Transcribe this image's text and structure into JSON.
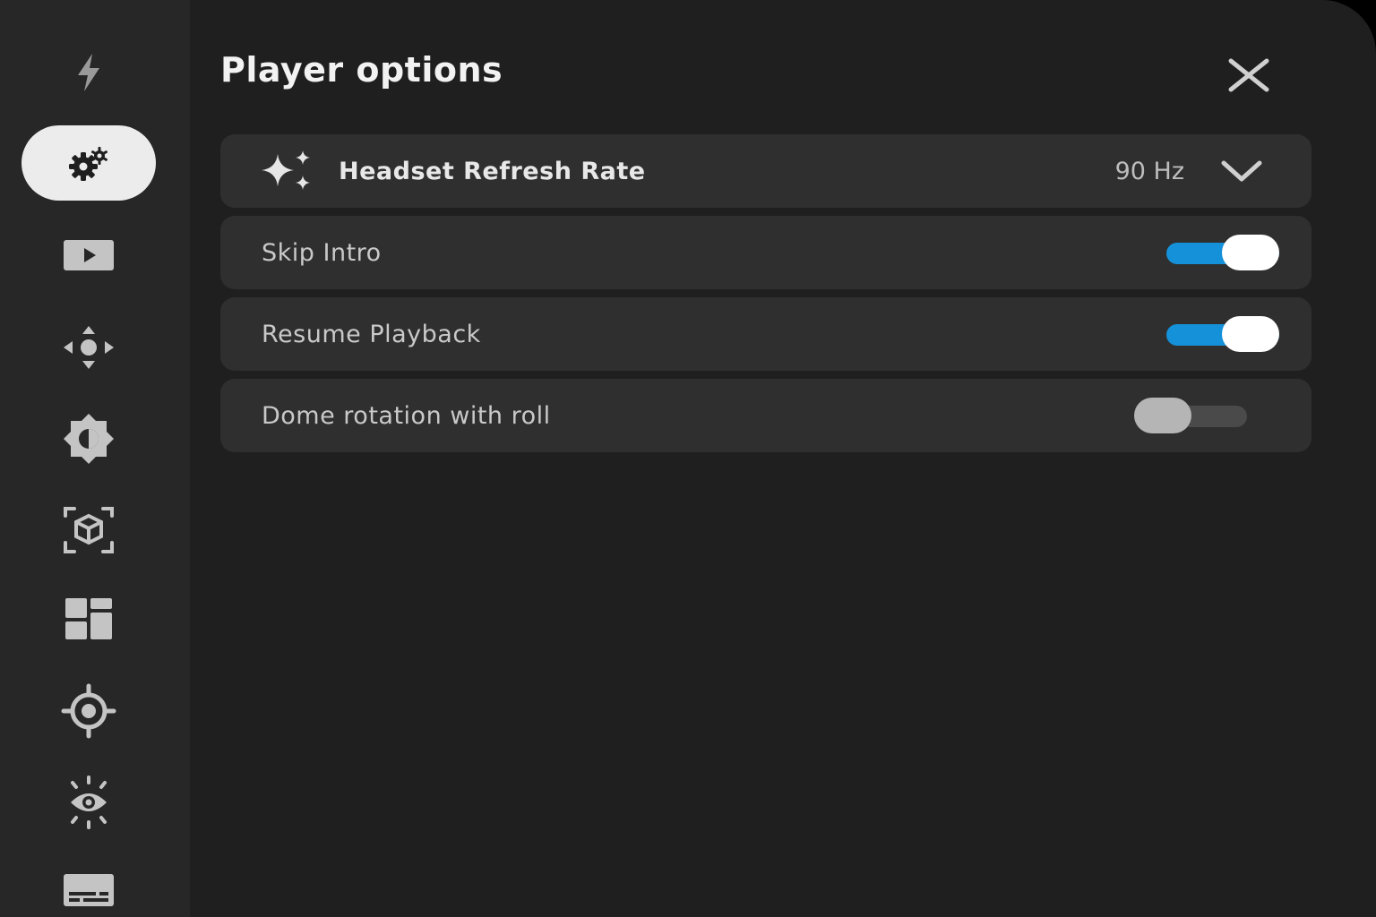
{
  "header": {
    "title": "Player options",
    "close_icon": "close-icon"
  },
  "sidebar": {
    "items": [
      {
        "icon": "lightning-icon",
        "active": false
      },
      {
        "icon": "gears-icon",
        "active": true
      },
      {
        "icon": "video-play-icon",
        "active": false
      },
      {
        "icon": "move-arrows-icon",
        "active": false
      },
      {
        "icon": "brightness-icon",
        "active": false
      },
      {
        "icon": "3d-cube-icon",
        "active": false
      },
      {
        "icon": "layout-grid-icon",
        "active": false
      },
      {
        "icon": "target-icon",
        "active": false
      },
      {
        "icon": "eye-sun-icon",
        "active": false
      },
      {
        "icon": "subtitles-icon",
        "active": false
      }
    ]
  },
  "settings": {
    "refresh_rate": {
      "label": "Headset Refresh Rate",
      "value": "90 Hz",
      "icon": "sparkle-icon"
    },
    "skip_intro": {
      "label": "Skip Intro",
      "enabled": true
    },
    "resume_playback": {
      "label": "Resume Playback",
      "enabled": true
    },
    "dome_rotation": {
      "label": "Dome rotation with roll",
      "enabled": false
    }
  },
  "colors": {
    "background": "#1f1f1f",
    "sidebar": "#272727",
    "row": "#2f2f2f",
    "accent": "#1591d9",
    "active_nav": "#ececec"
  }
}
